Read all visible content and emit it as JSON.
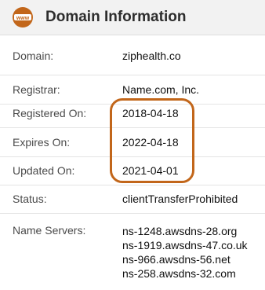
{
  "header": {
    "icon_name": "www-icon",
    "icon_text": "www",
    "title": "Domain Information"
  },
  "colors": {
    "accent": "#c2661a",
    "header_bg": "#f2f2f2"
  },
  "rows": [
    {
      "label": "Domain:",
      "value": "ziphealth.co"
    },
    {
      "label": "Registrar:",
      "value": "Name.com, Inc."
    },
    {
      "label": "Registered On:",
      "value": "2018-04-18"
    },
    {
      "label": "Expires On:",
      "value": "2022-04-18"
    },
    {
      "label": "Updated On:",
      "value": "2021-04-01"
    },
    {
      "label": "Status:",
      "value": "clientTransferProhibited"
    }
  ],
  "name_servers": {
    "label": "Name Servers:",
    "values": [
      "ns-1248.awsdns-28.org",
      "ns-1919.awsdns-47.co.uk",
      "ns-966.awsdns-56.net",
      "ns-258.awsdns-32.com"
    ]
  }
}
